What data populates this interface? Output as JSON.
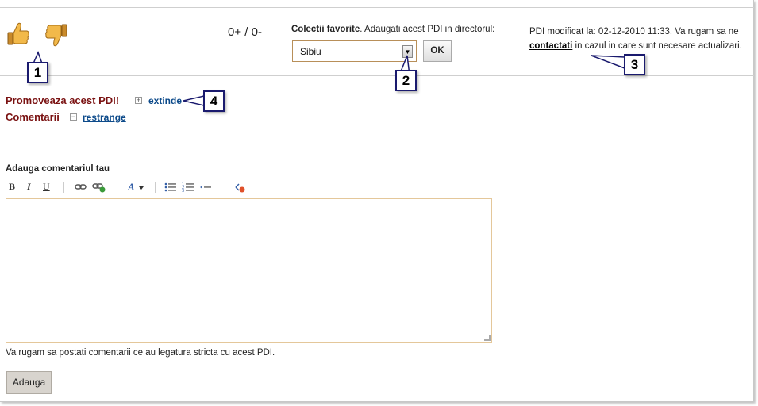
{
  "rating": {
    "like_icon": "thumbs-up-icon",
    "dislike_icon": "thumbs-down-icon",
    "score": "0+ / 0-"
  },
  "favorites": {
    "label_bold": "Colectii favorite",
    "label_rest": ". Adaugati acest PDI in directorul:",
    "selected": "Sibiu",
    "ok_label": "OK"
  },
  "modified": {
    "text_before": "PDI modificat la: 02-12-2010 11:33. Va rugam sa ne ",
    "link": "contactati",
    "text_after": " in cazul in care sunt necesare actualizari."
  },
  "callouts": [
    "1",
    "2",
    "3",
    "4"
  ],
  "promote": {
    "title": "Promoveaza acest PDI!",
    "toggle_symbol": "+",
    "link": "extinde"
  },
  "comments": {
    "title": "Comentarii",
    "toggle_symbol": "−",
    "link": "restrange"
  },
  "comment_form": {
    "heading": "Adauga comentariul tau",
    "toolbar": {
      "bold": "B",
      "italic": "I",
      "underline": "U"
    },
    "editor_value": "",
    "note": "Va rugam sa postati comentarii ce au legatura stricta cu acest PDI.",
    "submit_label": "Adauga"
  },
  "colors": {
    "section_title": "#7a1212",
    "link": "#0c4a8a",
    "callout_border": "#1a1a6e",
    "thumb": "#e8a838"
  }
}
